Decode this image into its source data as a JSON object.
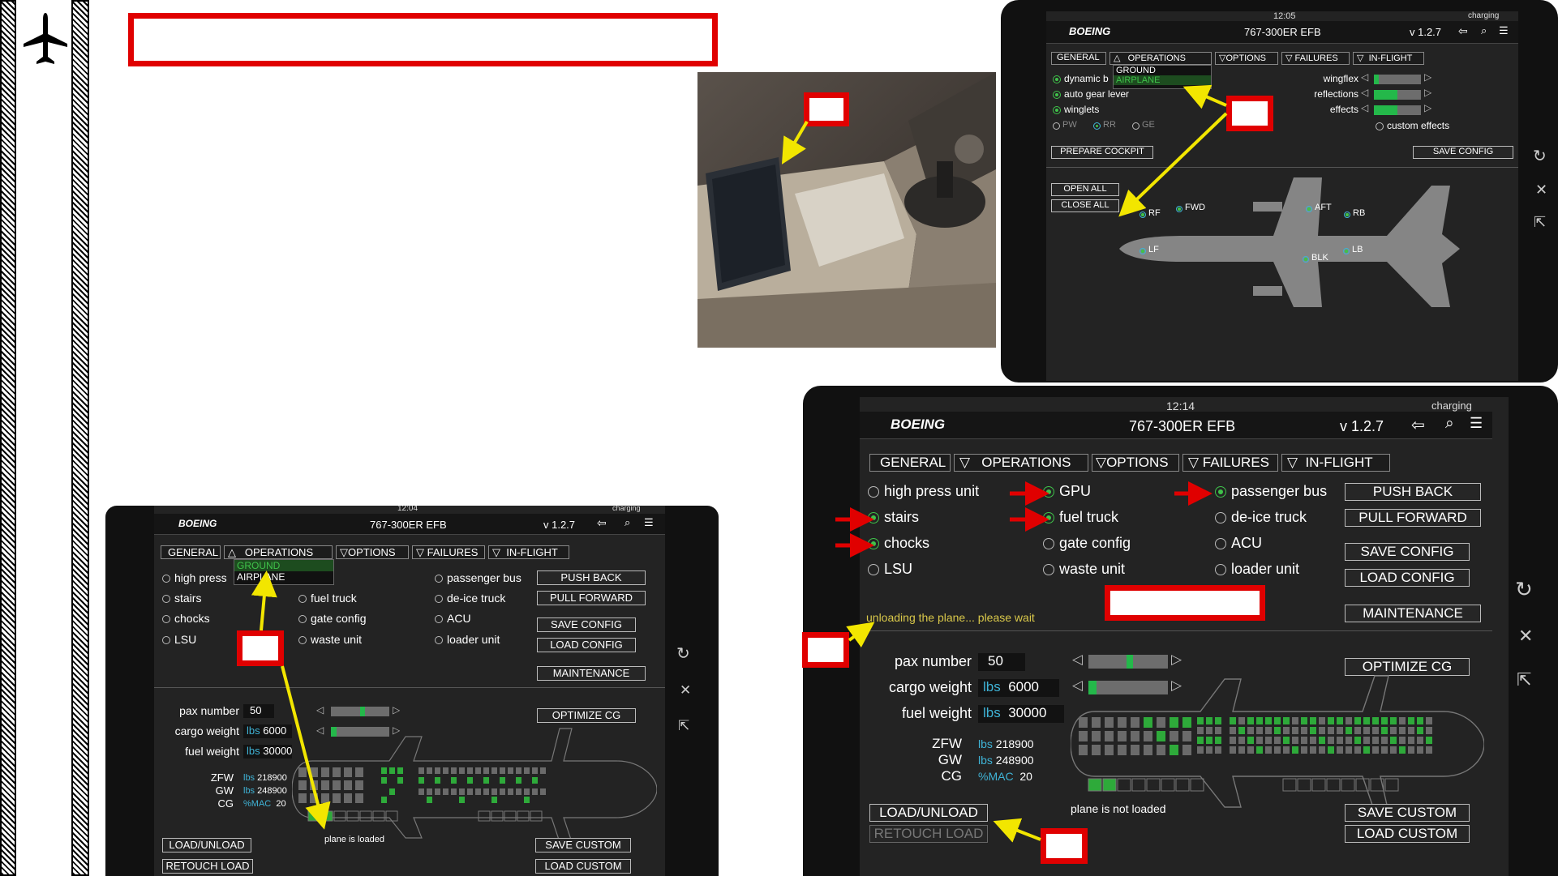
{
  "efb": {
    "brand": "BOEING",
    "title": "767-300ER EFB",
    "version": "v 1.2.7",
    "charging": "charging",
    "tabs": [
      "GENERAL",
      "OPERATIONS",
      "OPTIONS",
      "FAILURES",
      "IN-FLIGHT"
    ],
    "menu_ground": "GROUND",
    "menu_airplane": "AIRPLANE"
  },
  "screen_top": {
    "time": "12:05",
    "toggles": [
      "dynamic b",
      "auto gear lever",
      "winglets"
    ],
    "engines": [
      "PW",
      "RR",
      "GE"
    ],
    "engine_selected": "RR",
    "sliders": [
      {
        "label": "wingflex",
        "level": 0.05
      },
      {
        "label": "reflections",
        "level": 0.5
      },
      {
        "label": "effects",
        "level": 0.5
      }
    ],
    "custom_effects": "custom effects",
    "prepare_cockpit": "PREPARE COCKPIT",
    "save_config": "SAVE CONFIG",
    "open_all": "OPEN ALL",
    "close_all": "CLOSE ALL",
    "doors": [
      "RF",
      "FWD",
      "AFT",
      "RB",
      "LF",
      "BLK",
      "LB"
    ]
  },
  "screen_bottom_left": {
    "time": "12:04",
    "high_press": "high press",
    "status": "plane is loaded"
  },
  "screen_main": {
    "time": "12:14",
    "col1": [
      {
        "label": "high press unit",
        "on": false
      },
      {
        "label": "stairs",
        "on": true
      },
      {
        "label": "chocks",
        "on": true
      },
      {
        "label": "LSU",
        "on": false
      }
    ],
    "col2": [
      {
        "label": "GPU",
        "on": true
      },
      {
        "label": "fuel truck",
        "on": true
      },
      {
        "label": "gate config",
        "on": false
      },
      {
        "label": "waste unit",
        "on": false
      }
    ],
    "col3": [
      {
        "label": "passenger bus",
        "on": true
      },
      {
        "label": "de-ice truck",
        "on": false
      },
      {
        "label": "ACU",
        "on": false
      },
      {
        "label": "loader unit",
        "on": false
      }
    ],
    "buttons": {
      "push_back": "PUSH BACK",
      "pull_forward": "PULL FORWARD",
      "save_config": "SAVE CONFIG",
      "load_config": "LOAD CONFIG",
      "maintenance": "MAINTENANCE",
      "optimize_cg": "OPTIMIZE CG",
      "load_unload": "LOAD/UNLOAD",
      "retouch_load": "RETOUCH LOAD",
      "save_custom": "SAVE CUSTOM",
      "load_custom": "LOAD CUSTOM"
    },
    "message": "unloading the plane... please wait",
    "pax_label": "pax number",
    "pax_value": "50",
    "cargo_label": "cargo weight",
    "cargo_value": "6000",
    "fuel_label": "fuel weight",
    "fuel_value": "30000",
    "unit": "lbs",
    "zfw_label": "ZFW",
    "zfw_value": "218900",
    "gw_label": "GW",
    "gw_value": "248900",
    "cg_label": "CG",
    "cg_unit": "%MAC",
    "cg_value": "20",
    "status": "plane is not loaded",
    "pax_slider_level": 0.5,
    "cargo_slider_level": 0.1
  },
  "colors": {
    "callout_red": "#e00000",
    "arrow_yellow": "#f2e600",
    "active_green": "#3fc24a",
    "unit_cyan": "#3fb3d6"
  }
}
